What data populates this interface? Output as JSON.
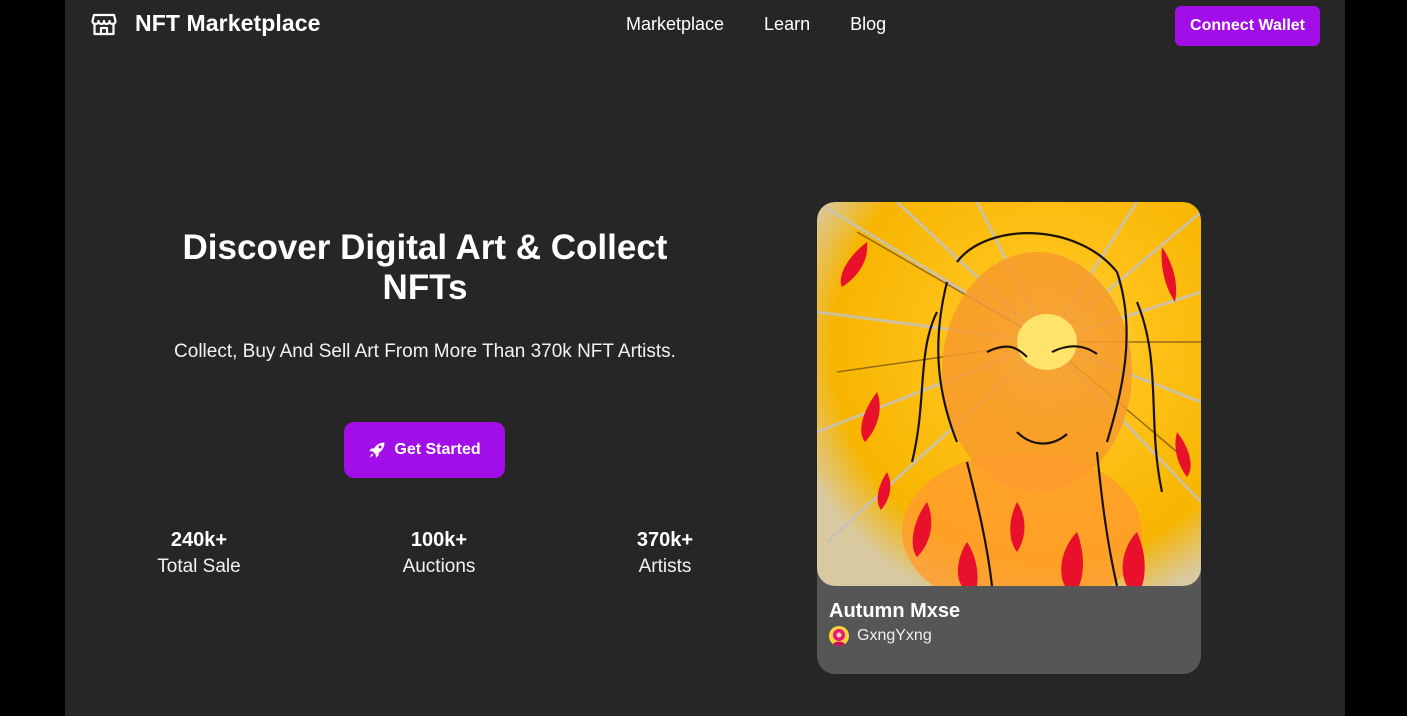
{
  "colors": {
    "accent": "#a20ee8",
    "page_background": "#262626",
    "card_background": "#565656"
  },
  "header": {
    "brand_icon": "storefront-icon",
    "brand_name": "NFT Marketplace",
    "nav": [
      {
        "label": "Marketplace"
      },
      {
        "label": "Learn"
      },
      {
        "label": "Blog"
      }
    ],
    "connect_label": "Connect Wallet"
  },
  "hero": {
    "title": "Discover Digital Art & Collect NFTs",
    "subtitle": "Collect, Buy And Sell Art From More Than 370k NFT Artists.",
    "cta_icon": "rocket-icon",
    "cta_label": "Get Started",
    "stats": [
      {
        "value": "240k+",
        "label": "Total Sale"
      },
      {
        "value": "100k+",
        "label": "Auctions"
      },
      {
        "value": "370k+",
        "label": "Artists"
      }
    ]
  },
  "featured": {
    "title": "Autumn Mxse",
    "artist": "GxngYxng",
    "artist_avatar": "artist-avatar"
  }
}
